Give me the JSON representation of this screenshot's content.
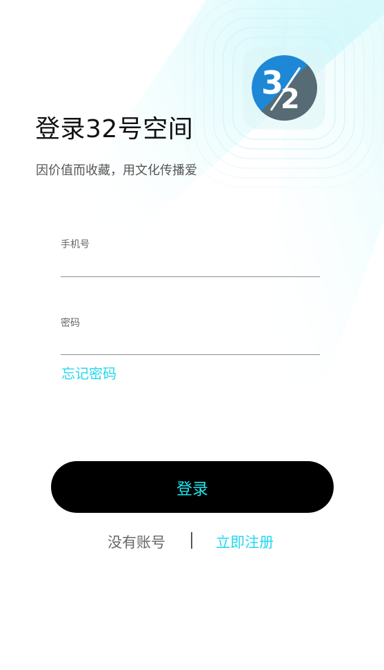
{
  "header": {
    "title": "登录32号空间",
    "slogan": "因价值而收藏，用文化传播爱"
  },
  "logo": {
    "digit_top": "3",
    "digit_bottom": "2",
    "color_blue": "#1e88d6",
    "color_gray": "#566b73"
  },
  "form": {
    "phone_label": "手机号",
    "password_label": "密码",
    "forgot_label": "忘记密码"
  },
  "actions": {
    "login_label": "登录",
    "no_account_label": "没有账号",
    "register_label": "立即注册"
  },
  "colors": {
    "accent": "#22d8ee",
    "button_bg": "#000000"
  }
}
